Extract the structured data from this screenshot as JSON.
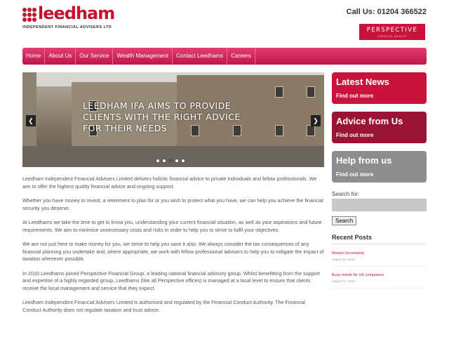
{
  "header": {
    "logo_word": "leedham",
    "logo_tagline": "INDEPENDENT FINANCIAL ADVISERS LTD",
    "call": "Call Us: 01204 366522",
    "perspective_name": "PERSPECTIVE",
    "perspective_sub": "CREATIVE WEALTH"
  },
  "nav": {
    "items": [
      "Home",
      "About Us",
      "Our Service",
      "Wealth Management",
      "Contact Leedhams",
      "Careers"
    ]
  },
  "slider": {
    "caption": "Leedham IFA aims to provide clients with the right advice for their needs",
    "prev_arrow": "❮",
    "next_arrow": "❯",
    "slide_count": 5,
    "active_slide": 2
  },
  "content": {
    "paragraphs": [
      "Leedham Independent Financial Advisers Limited delivers holistic financial advice to private individuals and fellow professionals. We aim to offer the highest quality financial advice and ongoing support.",
      "Whether you have money to invest, a retirement to plan for or you wish to protect what you have, we can help you achieve the financial security you deserve.",
      "At Leedhams we take the time to get to know you, understanding your current financial situation, as well as your aspirations and future requirements. We aim to minimise unnecessary costs and risks in order to help you to strive to fulfil your objectives.",
      "We are not just here to make money for you, we strive to help you save it also. We always consider the tax consequences of any financial planning you undertake and, where appropriate, we work with fellow professional advisers to help you to mitigate the impact of taxation whenever possible.",
      "In 2010 Leedhams joined Perspective Financial Group, a leading national financial advisory group. Whilst benefitting from the support and expertise of a highly regarded group, Leedhams (like all Perspective offices) is managed at a local level to ensure that clients receive the local management and service that they expect.",
      "Leedham Independent Financial Advisers Limited is authorised and regulated by the Financial Conduct Authority. The Financial Conduct Authority does not regulate taxation and trust advice."
    ]
  },
  "sidebar": {
    "boxes": [
      {
        "title": "Latest News",
        "link": "Find out more",
        "color": "#c8143c"
      },
      {
        "title": "Advice from Us",
        "link": "Find out more",
        "color": "#9a1535"
      },
      {
        "title": "Help from us",
        "link": "Find out more",
        "color": "#8e8e8e"
      }
    ],
    "search_label": "Search for:",
    "search_value": "",
    "search_button": "Search",
    "recent_title": "Recent Posts",
    "posts": [
      {
        "title": "Market Uncertainty",
        "date": "August 24, 2015"
      },
      {
        "title": "Busy month for UK companies",
        "date": "August 17, 2015"
      }
    ]
  },
  "colors": {
    "brand": "#c8102e",
    "nav": "#d12a5c"
  }
}
